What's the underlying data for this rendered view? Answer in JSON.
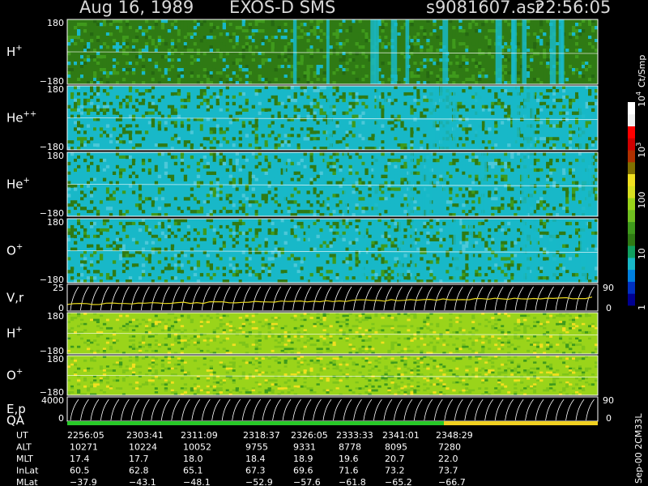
{
  "header": {
    "date": "Aug 16, 1989",
    "instrument": "EXOS-D SMS",
    "file": "s9081607.asr",
    "time": "22:56:05"
  },
  "colors": {
    "background": "#000000",
    "dark_green": "#2f7a14",
    "mid_green": "#3f9a1c",
    "cyan": "#18b8c8",
    "yellow_green": "#9ad41a",
    "yellow": "#f0e020",
    "trace_white": "#ffffff",
    "trace_yellow": "#e8d820",
    "qa_green": "#28c828",
    "qa_yellow": "#f0d020"
  },
  "chart_data": {
    "type": "heatmap",
    "panels": [
      {
        "name": "H",
        "sup": "+",
        "ymax": "180",
        "ymin": "−180",
        "dominant": "dark_green"
      },
      {
        "name": "He",
        "sup": "++",
        "ymax": "180",
        "ymin": "−180",
        "dominant": "cyan"
      },
      {
        "name": "He",
        "sup": "+",
        "ymax": "180",
        "ymin": "−180",
        "dominant": "cyan"
      },
      {
        "name": "O",
        "sup": "+",
        "ymax": "180",
        "ymin": "−180",
        "dominant": "cyan"
      },
      {
        "name": "V,r",
        "sup": "",
        "ymax": "25",
        "ymin": "0",
        "right_max": "90",
        "right_min": "0",
        "dominant": "line"
      },
      {
        "name": "H",
        "sup": "+",
        "ymax": "180",
        "ymin": "−180",
        "dominant": "yellow_green"
      },
      {
        "name": "O",
        "sup": "+",
        "ymax": "180",
        "ymin": "−180",
        "dominant": "yellow_green"
      },
      {
        "name": "E,p",
        "sup": "",
        "ymax": "4000",
        "ymin": "0",
        "right_max": "90",
        "right_min": "0",
        "dominant": "line"
      }
    ],
    "qa_label": "QA",
    "qa_segments": [
      {
        "color": "qa_green",
        "from": 0.0,
        "to": 0.71
      },
      {
        "color": "qa_yellow",
        "from": 0.71,
        "to": 1.0
      }
    ],
    "colorbar": {
      "unit": "Ct/Smp",
      "ticks": [
        {
          "label": "1",
          "sup": "",
          "frac": 0.0
        },
        {
          "label": "10",
          "sup": "",
          "frac": 0.25
        },
        {
          "label": "100",
          "sup": "",
          "frac": 0.5
        },
        {
          "label": "10",
          "sup": "3",
          "frac": 0.75
        },
        {
          "label": "10",
          "sup": "4",
          "frac": 1.0
        }
      ],
      "stops": [
        "#000090",
        "#0030c0",
        "#0080e0",
        "#18b8c8",
        "#10a060",
        "#2f7a14",
        "#3f9a1c",
        "#70c020",
        "#9ad41a",
        "#d8e020",
        "#f0e020",
        "#807000",
        "#b03000",
        "#d00000",
        "#ff0000",
        "#f0f0f0",
        "#ffffff"
      ]
    },
    "footer": {
      "rows": [
        {
          "label": "UT",
          "values": [
            "2256:05",
            "2303:41",
            "2311:09",
            "2318:37",
            "2326:05",
            "2333:33",
            "2341:01",
            "2348:29"
          ]
        },
        {
          "label": "ALT",
          "values": [
            "10271",
            "10224",
            "10052",
            "9755",
            "9331",
            "8778",
            "8095",
            "7280"
          ]
        },
        {
          "label": "MLT",
          "values": [
            "17.4",
            "17.7",
            "18.0",
            "18.4",
            "18.9",
            "19.6",
            "20.7",
            "22.0"
          ]
        },
        {
          "label": "InLat",
          "values": [
            "60.5",
            "62.8",
            "65.1",
            "67.3",
            "69.6",
            "71.6",
            "73.2",
            "73.7"
          ]
        },
        {
          "label": "MLat",
          "values": [
            "−37.9",
            "−43.1",
            "−48.1",
            "−52.9",
            "−57.6",
            "−61.8",
            "−65.2",
            "−66.7"
          ]
        }
      ]
    },
    "version": "Sep-00 2CM33L"
  }
}
